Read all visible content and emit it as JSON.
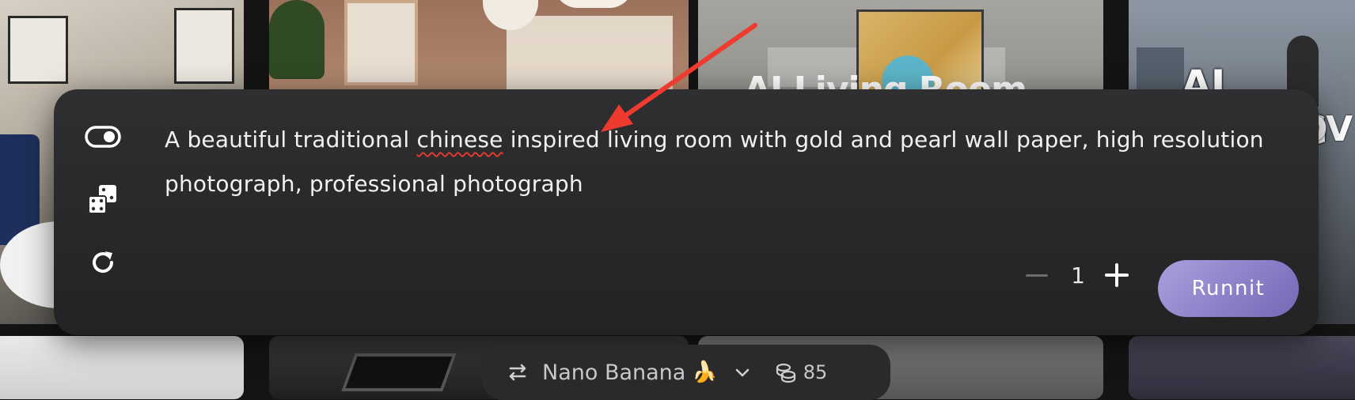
{
  "gallery": {
    "overlay_titles": [
      "AI Living Room",
      "AI LIVING",
      "OV"
    ]
  },
  "prompt_panel": {
    "prompt_text_before": "A beautiful traditional ",
    "prompt_misspelled_word": "chinese",
    "prompt_text_after": " inspired living room with gold and pearl wall paper, high resolution photograph, professional photograph",
    "icons": [
      "toggle-icon",
      "dice-icon",
      "refresh-icon"
    ],
    "quantity": "1",
    "run_label": "Runnit",
    "run_colors": [
      "#a9a1dc",
      "#7568b5"
    ]
  },
  "annotation": {
    "arrow_color": "#ee3a2f"
  },
  "model_bar": {
    "model_name": "Nano Banana",
    "model_emoji": "🍌",
    "credits": "85",
    "icons": [
      "swap-icon",
      "chevron-down-icon",
      "coins-icon"
    ]
  }
}
